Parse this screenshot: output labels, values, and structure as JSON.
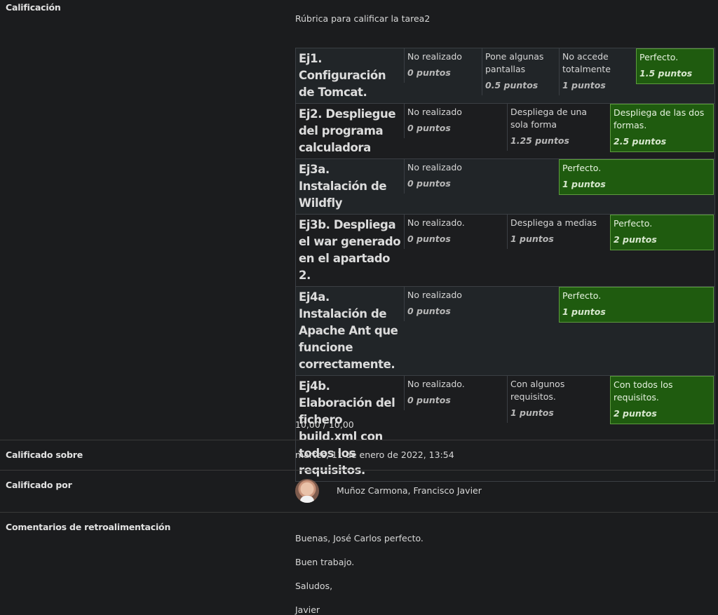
{
  "calificacion": {
    "label": "Calificación",
    "rubric_title": "Rúbrica para calificar la tarea2",
    "criteria": [
      {
        "desc": "Ej1. Configuración de Tomcat.",
        "levels": [
          {
            "def": "No realizado",
            "score": "0 puntos",
            "selected": false,
            "w": 111
          },
          {
            "def": "Pone algunas pantallas",
            "score": "0.5 puntos",
            "selected": false,
            "w": 110
          },
          {
            "def": "No accede totalmente",
            "score": "1 puntos",
            "selected": false,
            "w": 110
          },
          {
            "def": "Perfecto.",
            "score": "1.5 puntos",
            "selected": true,
            "w": 111
          }
        ]
      },
      {
        "desc": "Ej2. Despliegue del programa calculadora",
        "levels": [
          {
            "def": "No realizado",
            "score": "0 puntos",
            "selected": false,
            "w": 147
          },
          {
            "def": "Despliega de una sola forma",
            "score": "1.25 puntos",
            "selected": false,
            "w": 147
          },
          {
            "def": "Despliega de las dos formas.",
            "score": "2.5 puntos",
            "selected": true,
            "w": 148
          }
        ]
      },
      {
        "desc": "Ej3a. Instalación de Wildfly",
        "levels": [
          {
            "def": "No realizado",
            "score": "0 puntos",
            "selected": false,
            "w": 221
          },
          {
            "def": "Perfecto.",
            "score": "1 puntos",
            "selected": true,
            "w": 221
          }
        ]
      },
      {
        "desc": "Ej3b. Despliega el war generado en el apartado 2.",
        "levels": [
          {
            "def": "No realizado.",
            "score": "0 puntos",
            "selected": false,
            "w": 147
          },
          {
            "def": "Despliega a medias",
            "score": "1 puntos",
            "selected": false,
            "w": 147
          },
          {
            "def": "Perfecto.",
            "score": "2 puntos",
            "selected": true,
            "w": 148
          }
        ]
      },
      {
        "desc": "Ej4a. Instalación de Apache Ant que funcione correctamente.",
        "levels": [
          {
            "def": "No realizado",
            "score": "0 puntos",
            "selected": false,
            "w": 221
          },
          {
            "def": "Perfecto.",
            "score": "1 puntos",
            "selected": true,
            "w": 221
          }
        ]
      },
      {
        "desc": "Ej4b. Elaboración del fichero build.xml con todos los requisitos.",
        "levels": [
          {
            "def": "No realizado.",
            "score": "0 puntos",
            "selected": false,
            "w": 147
          },
          {
            "def": "Con algunos requisitos.",
            "score": "1 puntos",
            "selected": false,
            "w": 147
          },
          {
            "def": "Con todos los requisitos.",
            "score": "2 puntos",
            "selected": true,
            "w": 148
          }
        ]
      }
    ],
    "total": "10,00 / 10,00"
  },
  "calificado_sobre": {
    "label": "Calificado sobre",
    "value": "martes, 11 de enero de 2022, 13:54"
  },
  "calificado_por": {
    "label": "Calificado por",
    "name": "Muñoz Carmona, Francisco Javier"
  },
  "comentarios": {
    "label": "Comentarios de retroalimentación",
    "lines": [
      "Buenas, José Carlos perfecto.",
      "Buen trabajo.",
      "Saludos,",
      "Javier"
    ]
  }
}
